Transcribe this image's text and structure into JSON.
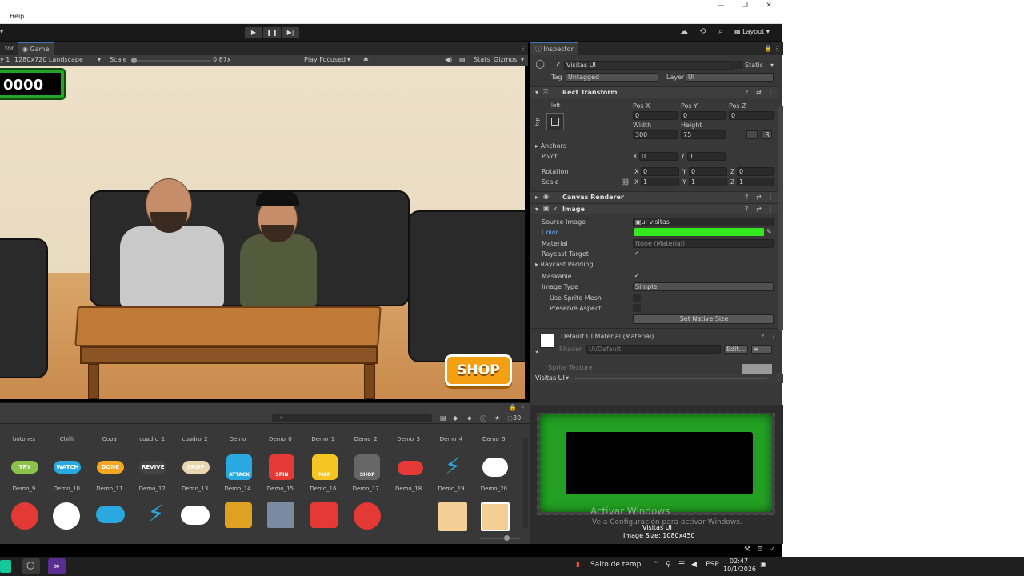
{
  "menu": {
    "help": "Help",
    "left_edge": "."
  },
  "toolbar": {
    "layout_label": "Layout",
    "layout_dropdown": "▾"
  },
  "game": {
    "tabs": [
      {
        "label": "tor"
      },
      {
        "label": "Game"
      }
    ],
    "display": "y 1",
    "resolution": "1280x720 Landscape",
    "scale_label": "Scale",
    "scale_value": "0.87x",
    "play_focus": "Play Focused",
    "stats": "Stats",
    "gizmos": "Gizmos",
    "score": "0000",
    "shop_button": "SHOP"
  },
  "project": {
    "item_count": "30",
    "row1_names": [
      "botones",
      "Chilli",
      "Copa",
      "cuadro_1",
      "cuadro_2",
      "Demo",
      "Demo_0",
      "Demo_1",
      "Demo_2",
      "Demo_3",
      "Demo_4",
      "Demo_5"
    ],
    "row2_names": [
      "Demo_9",
      "Demo_10",
      "Demo_11",
      "Demo_12",
      "Demo_13",
      "Demo_14",
      "Demo_15",
      "Demo_16",
      "Demo_17",
      "Demo_18",
      "Demo_19",
      "Demo_20"
    ],
    "row1_icons": [
      {
        "label": "TRY",
        "color": "#8bc34a"
      },
      {
        "label": "WATCH",
        "color": "#29a9e0"
      },
      {
        "label": "DONE",
        "color": "#f5a623"
      },
      {
        "label": "REVIVE",
        "color": "#444444"
      },
      {
        "label": "SHOP",
        "color": "#e8d7b0"
      },
      {
        "label": "ATTACK",
        "color": "#29a9e0"
      },
      {
        "label": "SPIN",
        "color": "#e53935"
      },
      {
        "label": "MAP",
        "color": "#f5c623"
      },
      {
        "label": "SHOP",
        "color": "#666666"
      },
      {
        "label": "",
        "color": "#e53935"
      },
      {
        "label": "",
        "color": "#29a9e0"
      },
      {
        "label": "",
        "color": "#ffffff"
      }
    ]
  },
  "inspector": {
    "tab_label": "Inspector",
    "object_name": "Visitas UI",
    "static_label": "Static",
    "tag_label": "Tag",
    "tag_value": "Untagged",
    "layer_label": "Layer",
    "layer_value": "UI",
    "rect_transform": {
      "title": "Rect Transform",
      "anchor_preset_top": "left",
      "anchor_preset_side": "top",
      "pos_x_label": "Pos X",
      "pos_x": "0",
      "pos_y_label": "Pos Y",
      "pos_y": "0",
      "pos_z_label": "Pos Z",
      "pos_z": "0",
      "width_label": "Width",
      "width": "300",
      "height_label": "Height",
      "height": "75",
      "blueprint_btn": "",
      "raw_btn": "R",
      "anchors_label": "Anchors",
      "pivot_label": "Pivot",
      "pivot_x_label": "X",
      "pivot_x": "0",
      "pivot_y_label": "Y",
      "pivot_y": "1",
      "rotation_label": "Rotation",
      "rot_x_label": "X",
      "rot_x": "0",
      "rot_y_label": "Y",
      "rot_y": "0",
      "rot_z_label": "Z",
      "rot_z": "0",
      "scale_label": "Scale",
      "scale_x_label": "X",
      "scale_x": "1",
      "scale_y_label": "Y",
      "scale_y": "1",
      "scale_z_label": "Z",
      "scale_z": "1"
    },
    "canvas_renderer": {
      "title": "Canvas Renderer"
    },
    "image": {
      "title": "Image",
      "source_image_label": "Source Image",
      "source_image_value": "ui visitas",
      "color_label": "Color",
      "color_value": "#33e81e",
      "material_label": "Material",
      "material_value": "None (Material)",
      "raycast_target_label": "Raycast Target",
      "raycast_padding_label": "Raycast Padding",
      "maskable_label": "Maskable",
      "image_type_label": "Image Type",
      "image_type_value": "Simple",
      "use_sprite_mesh_label": "Use Sprite Mesh",
      "preserve_aspect_label": "Preserve Aspect",
      "set_native_size": "Set Native Size"
    },
    "material": {
      "title": "Default UI Material (Material)",
      "shader_label": "Shader",
      "shader_value": "UI/Default",
      "edit_button": "Edit...",
      "edit_dropdown": "≡",
      "sprite_texture_label": "Sprite Texture"
    },
    "preview": {
      "header": "Visitas UI",
      "caption_name": "Visitas UI",
      "caption_size": "Image Size: 1080x450"
    }
  },
  "watermark": {
    "title": "Activar Windows",
    "subtitle": "Ve a Configuración para activar Windows."
  },
  "taskbar": {
    "weather": "Salto de temp.",
    "language": "ESP",
    "time": "02:47",
    "date": "10/1/2026"
  }
}
